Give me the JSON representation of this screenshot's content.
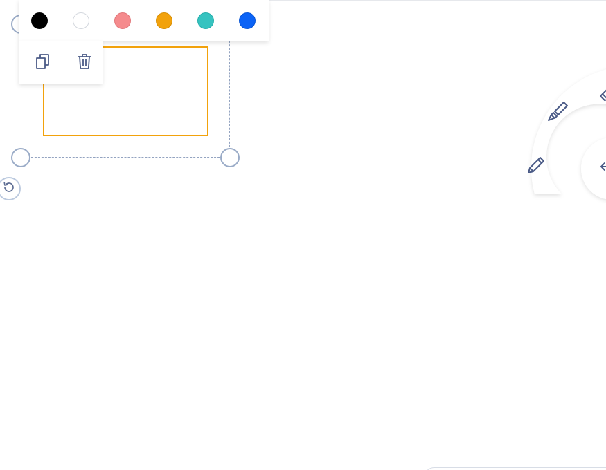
{
  "canvas": {
    "background": "#ffffff"
  },
  "shape": {
    "kind": "rectangle",
    "stroke_color": "#f2a20c"
  },
  "color_toolbar": {
    "swatches": [
      {
        "name": "black",
        "color": "#000000"
      },
      {
        "name": "white",
        "color": "#ffffff"
      },
      {
        "name": "pink",
        "color": "#f58b8d"
      },
      {
        "name": "orange",
        "color": "#f2a20c"
      },
      {
        "name": "teal",
        "color": "#36c3c0"
      },
      {
        "name": "blue",
        "color": "#0b63f6"
      }
    ]
  },
  "action_toolbar": {
    "actions": [
      {
        "name": "duplicate",
        "icon": "copy-icon"
      },
      {
        "name": "delete",
        "icon": "trash-icon"
      }
    ]
  },
  "radial_menu": {
    "tools": [
      {
        "name": "pencil",
        "icon": "pencil-icon"
      },
      {
        "name": "highlighter",
        "icon": "highlighter-icon"
      },
      {
        "name": "eraser",
        "icon": "eraser-icon"
      },
      {
        "name": "back",
        "icon": "arrow-left-icon"
      }
    ]
  },
  "accent_colors": {
    "icon": "#4a5a86",
    "handle": "#9aabc7"
  }
}
